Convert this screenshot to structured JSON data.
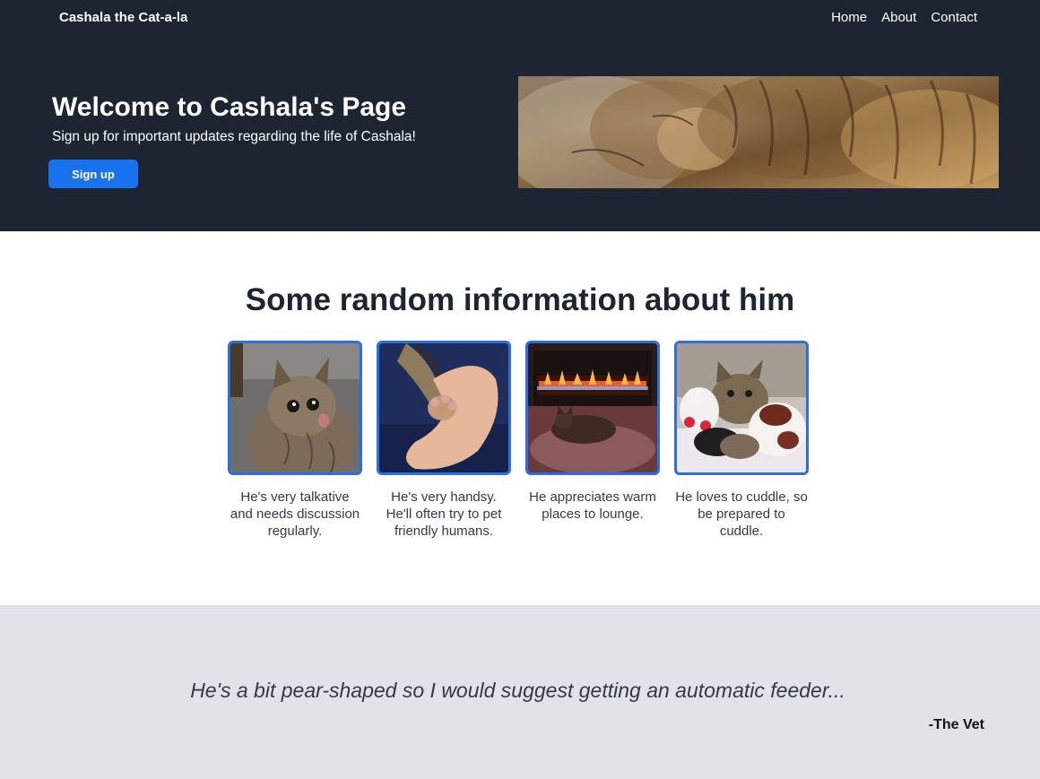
{
  "navbar": {
    "brand": "Cashala the Cat-a-la",
    "links": [
      "Home",
      "About",
      "Contact"
    ]
  },
  "hero": {
    "title": "Welcome to Cashala's Page",
    "subtitle": "Sign up for important updates regarding the life of Cashala!",
    "signup_label": "Sign up",
    "image_icon": "sleeping-tabby-cat-photo"
  },
  "features": {
    "title": "Some random information about him",
    "cards": [
      {
        "image_icon": "talkative-cat-photo",
        "caption": "He's very talkative and needs discussion regularly."
      },
      {
        "image_icon": "cat-paw-in-hand-photo",
        "caption": "He's very handsy. He'll often try to pet friendly humans."
      },
      {
        "image_icon": "cat-by-fireplace-photo",
        "caption": "He appreciates warm places to lounge."
      },
      {
        "image_icon": "cat-with-plush-toys-photo",
        "caption": "He loves to cuddle, so be prepared to cuddle."
      }
    ]
  },
  "quote": {
    "text": "He's a bit pear-shaped so I would suggest getting an automatic feeder...",
    "author": "-The Vet"
  },
  "colors": {
    "dark_bg": "#1e2532",
    "accent": "#1a73ee",
    "card_border": "#2b6fe0",
    "quote_bg": "#e1e3e8"
  }
}
